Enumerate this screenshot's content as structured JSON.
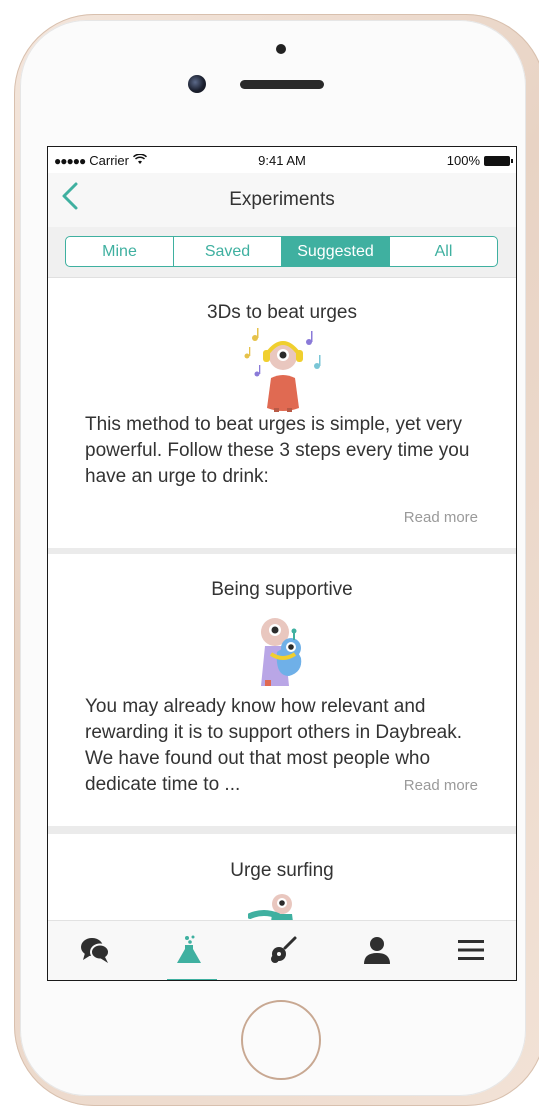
{
  "status_bar": {
    "signal": "●●●●●",
    "carrier": "Carrier",
    "wifi_icon": "wifi-icon",
    "time": "9:41 AM",
    "battery": "100%"
  },
  "nav": {
    "back_icon": "chevron-left-icon",
    "title": "Experiments"
  },
  "segments": [
    {
      "label": "Mine",
      "active": false
    },
    {
      "label": "Saved",
      "active": false
    },
    {
      "label": "Suggested",
      "active": true
    },
    {
      "label": "All",
      "active": false
    }
  ],
  "cards": [
    {
      "title": "3Ds to beat urges",
      "illustration": "character-with-headphones-music-notes",
      "body": "This method to beat urges is simple, yet very powerful. Follow these 3 steps every time you have an urge to drink:",
      "read_more": "Read more"
    },
    {
      "title": "Being supportive",
      "illustration": "two-characters-hugging",
      "body": "You may already know how relevant and rewarding it is to support others in Daybreak. We have found out that most people who dedicate time to ...",
      "read_more": "Read more"
    },
    {
      "title": "Urge surfing",
      "illustration": "character-surfing"
    }
  ],
  "tab_bar": {
    "tabs": [
      {
        "icon": "chat-bubbles-icon",
        "active": false
      },
      {
        "icon": "flask-icon",
        "active": true
      },
      {
        "icon": "guitar-icon",
        "active": false
      },
      {
        "icon": "person-icon",
        "active": false
      },
      {
        "icon": "menu-icon",
        "active": false
      }
    ]
  },
  "colors": {
    "accent": "#3fb0a0",
    "text": "#333333",
    "muted": "#9a9a9a",
    "phone_gold": "#e8d3c4"
  }
}
